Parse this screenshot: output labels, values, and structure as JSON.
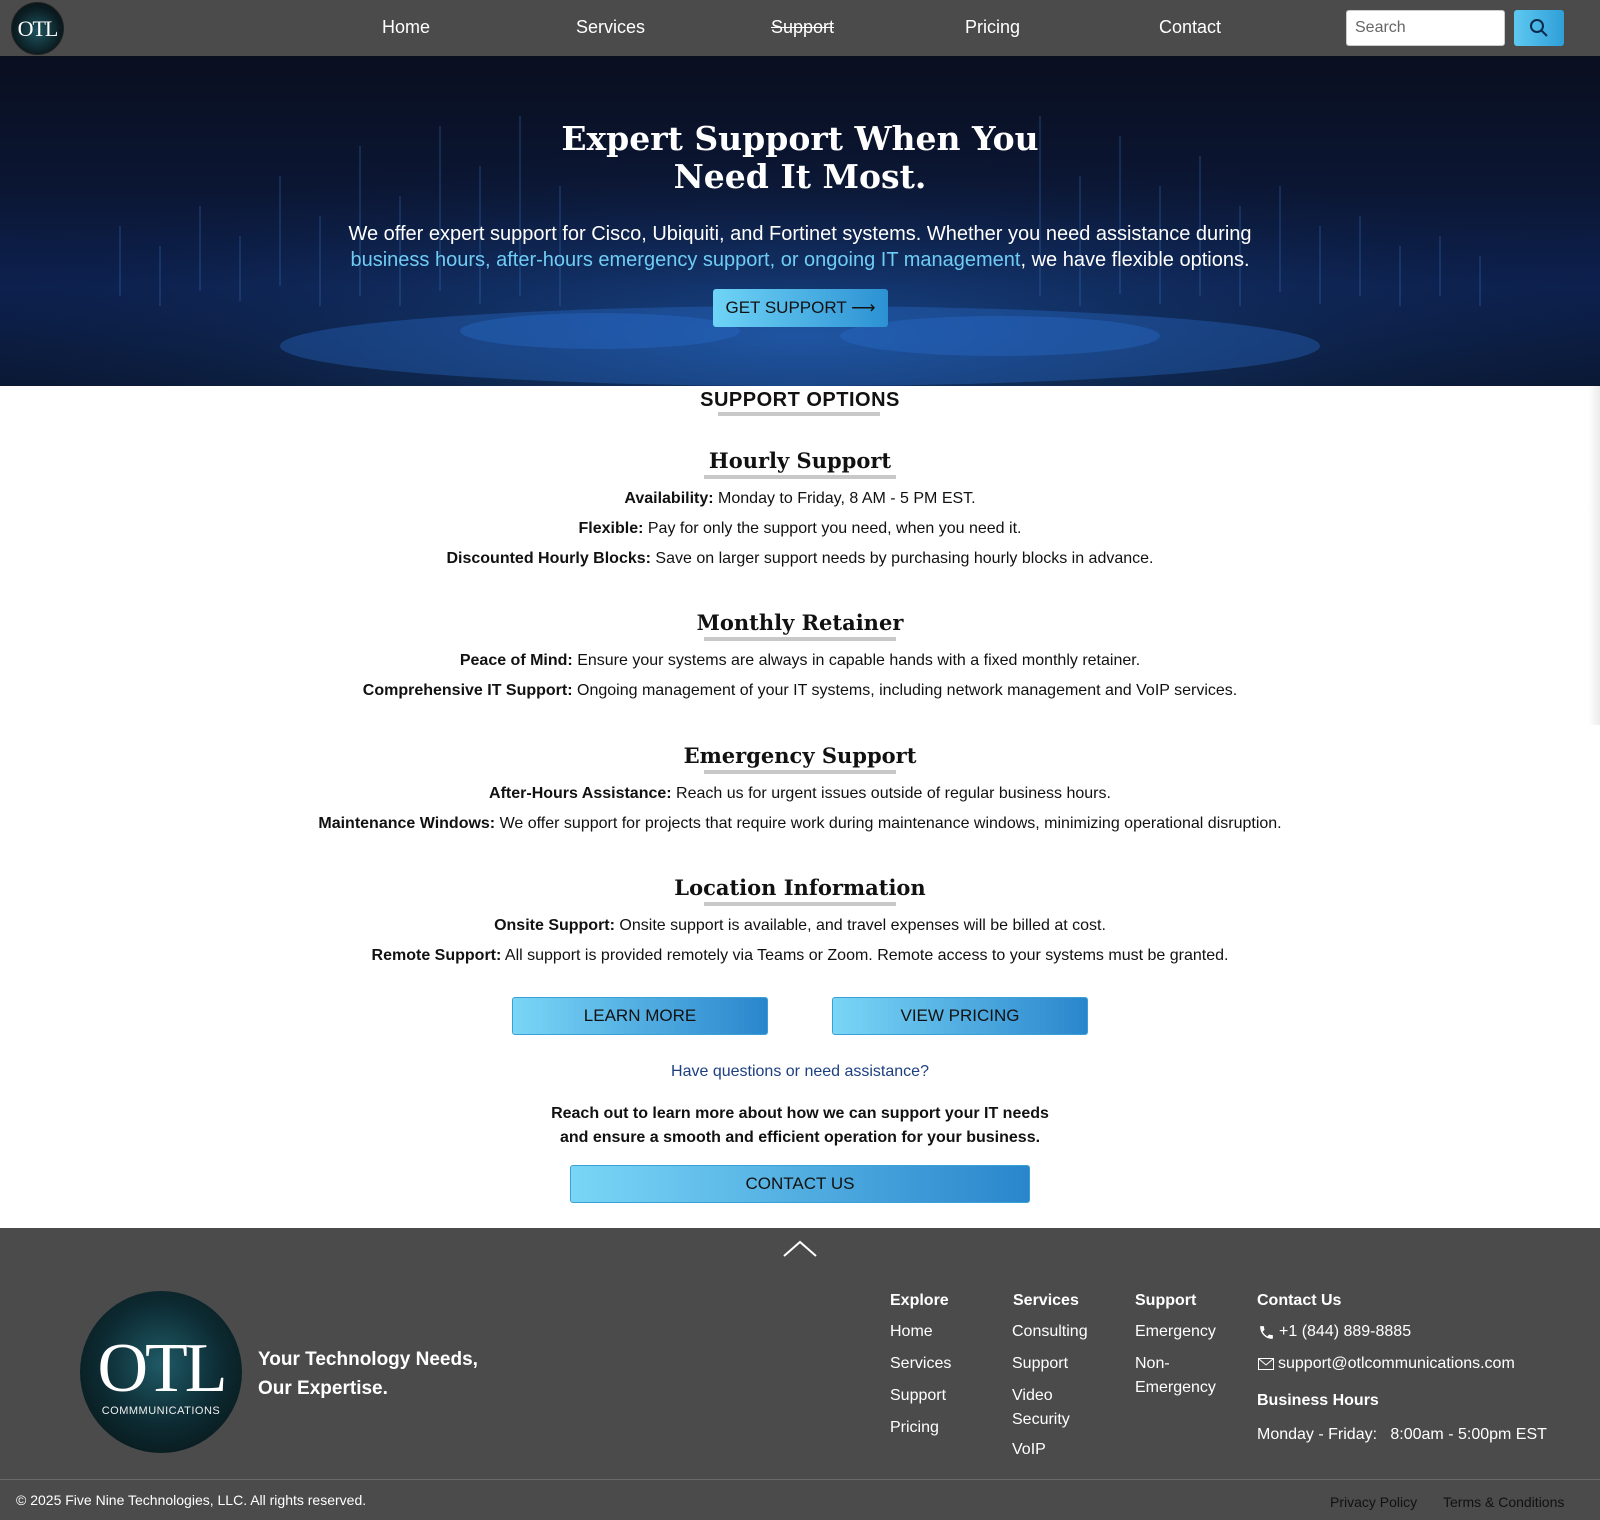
{
  "nav": {
    "logo_text": "OTL",
    "links": [
      {
        "label": "Home"
      },
      {
        "label": "Services"
      },
      {
        "label": "Support"
      },
      {
        "label": "Pricing"
      },
      {
        "label": "Contact"
      }
    ],
    "search_placeholder": "Search",
    "search_icon": "search-icon"
  },
  "hero": {
    "title_line1": "Expert Support When You",
    "title_line2": "Need It Most.",
    "text_line1": "We offer expert support for Cisco, Ubiquiti, and Fortinet systems. Whether you need assistance during",
    "text_highlight": "business hours, after-hours emergency support, or ongoing IT management",
    "text_tail": ", we have flexible options.",
    "button_label": "GET SUPPORT ⟶"
  },
  "support": {
    "section_title": "SUPPORT OPTIONS",
    "hourly": {
      "title": "Hourly Support",
      "items": [
        {
          "label": "Availability:",
          "text": " Monday to Friday, 8 AM - 5 PM EST."
        },
        {
          "label": "Flexible:",
          "text": " Pay for only the support you need, when you need it."
        },
        {
          "label": "Discounted Hourly Blocks:",
          "text": " Save on larger support needs by purchasing hourly blocks in advance."
        }
      ]
    },
    "monthly": {
      "title": "Monthly Retainer",
      "items": [
        {
          "label": "Peace of Mind:",
          "text": " Ensure your systems are always in capable hands with a fixed monthly retainer."
        },
        {
          "label": "Comprehensive IT Support:",
          "text": " Ongoing management of your IT systems, including network management and VoIP services."
        }
      ]
    },
    "emergency": {
      "title": "Emergency Support",
      "items": [
        {
          "label": "After-Hours Assistance:",
          "text": " Reach us for urgent issues outside of regular business hours."
        },
        {
          "label": "Maintenance Windows:",
          "text": " We offer support for projects that require work during maintenance windows, minimizing operational disruption."
        }
      ]
    },
    "location": {
      "title": "Location Information",
      "items": [
        {
          "label": "Onsite Support:",
          "text": " Onsite support is available, and travel expenses will be billed at cost."
        },
        {
          "label": "Remote Support:",
          "text": " All support is provided remotely via Teams or Zoom. Remote access to your systems must be granted."
        }
      ]
    },
    "learn_more": "LEARN MORE",
    "view_pricing": "VIEW PRICING",
    "question": "Have questions or need assistance?",
    "reach_line1": "Reach out to learn more about how we can support your IT needs",
    "reach_line2": "and ensure a smooth and efficient operation for your business.",
    "contact_us": "CONTACT US"
  },
  "footer": {
    "logo_big": "OTL",
    "logo_small": "COMMMUNICATIONS",
    "tagline_line1": "Your Technology Needs,",
    "tagline_line2": "Our Expertise.",
    "explore": {
      "heading": "Explore",
      "links": [
        "Home",
        "Services",
        "Support",
        "Pricing"
      ]
    },
    "services": {
      "heading": "Services",
      "links": [
        "Consulting",
        "Support",
        "Video",
        "Security",
        "VoIP"
      ]
    },
    "support": {
      "heading": "Support",
      "links": [
        "Emergency",
        "Non-",
        "Emergency"
      ]
    },
    "contact": {
      "heading": "Contact Us",
      "phone": "+1 (844) 889-8885",
      "email": "support@otlcommunications.com",
      "hours_heading": "Business Hours",
      "hours_days": "Monday - Friday:",
      "hours_time": "8:00am - 5:00pm EST"
    },
    "copyright": "© 2025 Five Nine Technologies, LLC. All rights reserved.",
    "privacy": "Privacy Policy",
    "terms": "Terms & Conditions"
  },
  "colors": {
    "nav_bg": "#4b4b4b",
    "accent": "#2f9fd8",
    "highlight": "#6fcdf5"
  }
}
